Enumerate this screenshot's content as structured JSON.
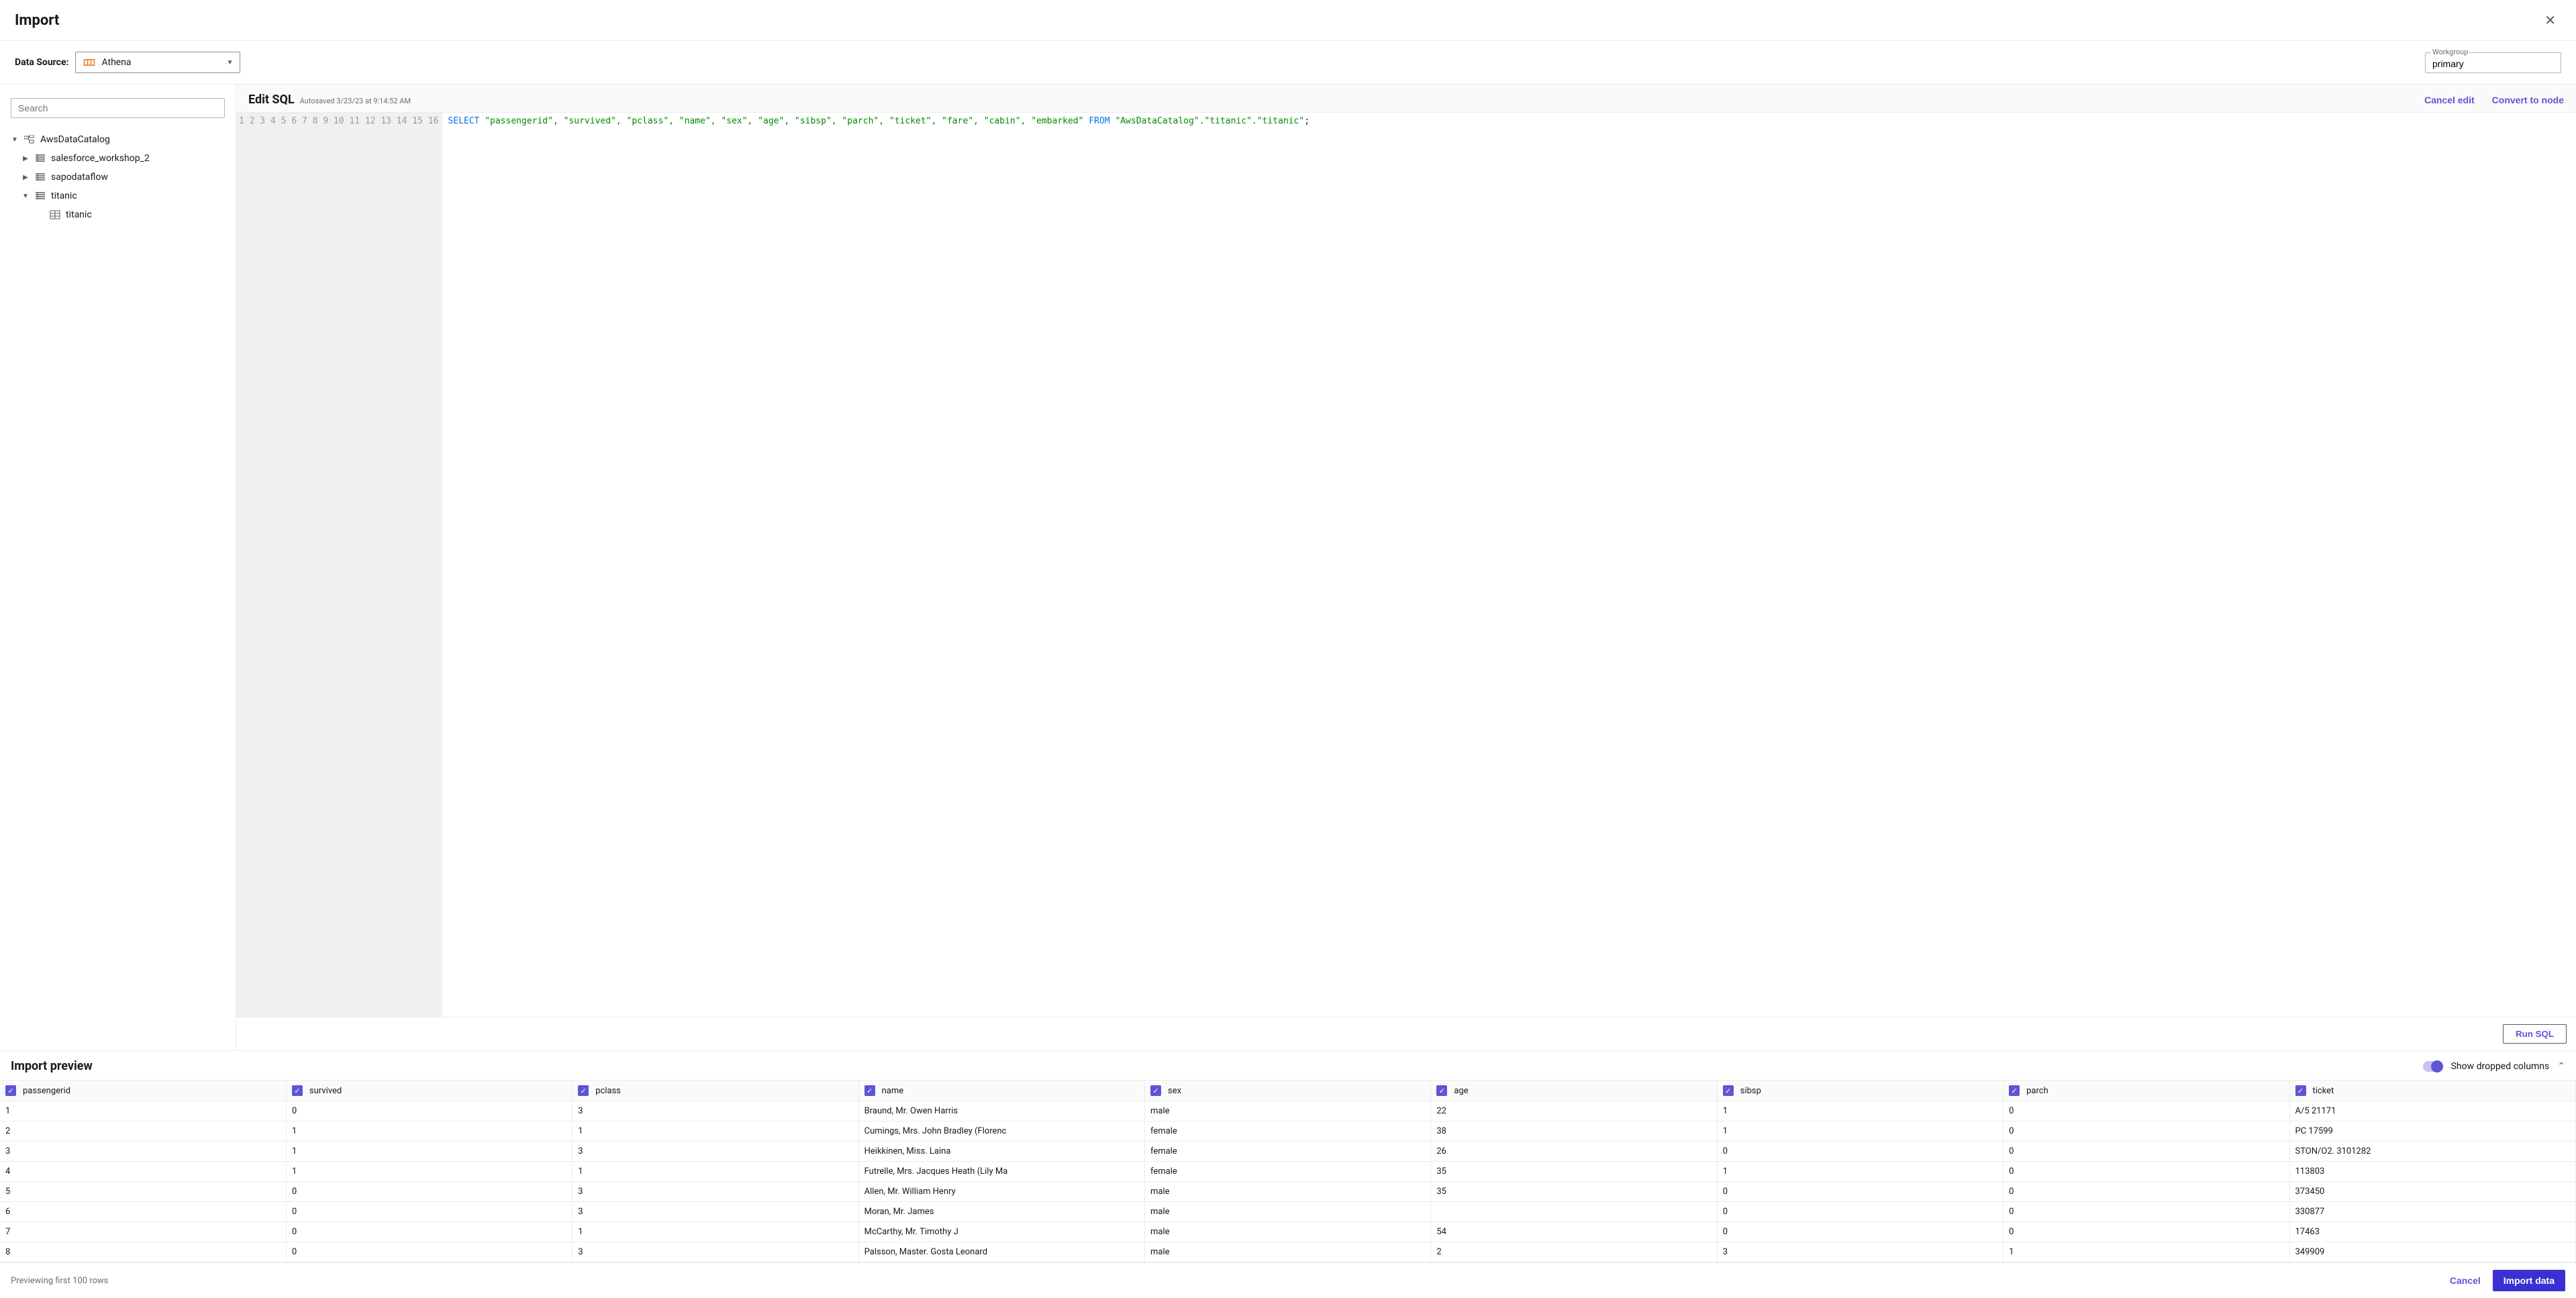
{
  "header": {
    "title": "Import"
  },
  "data_source": {
    "label": "Data Source:",
    "selected": "Athena",
    "workgroup_label": "Workgroup",
    "workgroup_value": "primary"
  },
  "sidebar": {
    "search_placeholder": "Search",
    "catalog": "AwsDataCatalog",
    "databases": [
      {
        "name": "salesforce_workshop_2",
        "expanded": false
      },
      {
        "name": "sapodataflow",
        "expanded": false
      },
      {
        "name": "titanic",
        "expanded": true,
        "tables": [
          "titanic"
        ]
      }
    ]
  },
  "editor": {
    "title": "Edit SQL",
    "autosaved": "Autosaved 3/23/23 at 9:14:52 AM",
    "cancel_edit": "Cancel edit",
    "convert": "Convert to node",
    "run": "Run SQL",
    "line_count": 16,
    "sql_keyword_select": "SELECT",
    "sql_cols": "\"passengerid\", \"survived\", \"pclass\", \"name\", \"sex\", \"age\", \"sibsp\", \"parch\", \"ticket\", \"fare\", \"cabin\", \"embarked\"",
    "sql_keyword_from": "FROM",
    "sql_table": "\"AwsDataCatalog\".\"titanic\".\"titanic\""
  },
  "preview": {
    "title": "Import preview",
    "toggle_label": "Show dropped columns",
    "columns": [
      "passengerid",
      "survived",
      "pclass",
      "name",
      "sex",
      "age",
      "sibsp",
      "parch",
      "ticket"
    ],
    "rows": [
      [
        "1",
        "0",
        "3",
        "Braund, Mr. Owen Harris",
        "male",
        "22",
        "1",
        "0",
        "A/5 21171"
      ],
      [
        "2",
        "1",
        "1",
        "Cumings, Mrs. John Bradley (Florenc",
        "female",
        "38",
        "1",
        "0",
        "PC 17599"
      ],
      [
        "3",
        "1",
        "3",
        "Heikkinen, Miss. Laina",
        "female",
        "26",
        "0",
        "0",
        "STON/O2. 3101282"
      ],
      [
        "4",
        "1",
        "1",
        "Futrelle, Mrs. Jacques Heath (Lily Ma",
        "female",
        "35",
        "1",
        "0",
        "113803"
      ],
      [
        "5",
        "0",
        "3",
        "Allen, Mr. William Henry",
        "male",
        "35",
        "0",
        "0",
        "373450"
      ],
      [
        "6",
        "0",
        "3",
        "Moran, Mr. James",
        "male",
        "",
        "0",
        "0",
        "330877"
      ],
      [
        "7",
        "0",
        "1",
        "McCarthy, Mr. Timothy J",
        "male",
        "54",
        "0",
        "0",
        "17463"
      ],
      [
        "8",
        "0",
        "3",
        "Palsson, Master. Gosta Leonard",
        "male",
        "2",
        "3",
        "1",
        "349909"
      ]
    ]
  },
  "footer": {
    "note": "Previewing first 100 rows",
    "cancel": "Cancel",
    "import": "Import data"
  },
  "chart_data": {
    "type": "table",
    "columns": [
      "passengerid",
      "survived",
      "pclass",
      "name",
      "sex",
      "age",
      "sibsp",
      "parch",
      "ticket"
    ],
    "rows": [
      [
        1,
        0,
        3,
        "Braund, Mr. Owen Harris",
        "male",
        22,
        1,
        0,
        "A/5 21171"
      ],
      [
        2,
        1,
        1,
        "Cumings, Mrs. John Bradley (Florenc",
        "female",
        38,
        1,
        0,
        "PC 17599"
      ],
      [
        3,
        1,
        3,
        "Heikkinen, Miss. Laina",
        "female",
        26,
        0,
        0,
        "STON/O2. 3101282"
      ],
      [
        4,
        1,
        1,
        "Futrelle, Mrs. Jacques Heath (Lily Ma",
        "female",
        35,
        1,
        0,
        "113803"
      ],
      [
        5,
        0,
        3,
        "Allen, Mr. William Henry",
        "male",
        35,
        0,
        0,
        "373450"
      ],
      [
        6,
        0,
        3,
        "Moran, Mr. James",
        "male",
        null,
        0,
        0,
        "330877"
      ],
      [
        7,
        0,
        1,
        "McCarthy, Mr. Timothy J",
        "male",
        54,
        0,
        0,
        "17463"
      ],
      [
        8,
        0,
        3,
        "Palsson, Master. Gosta Leonard",
        "male",
        2,
        3,
        1,
        "349909"
      ]
    ]
  }
}
